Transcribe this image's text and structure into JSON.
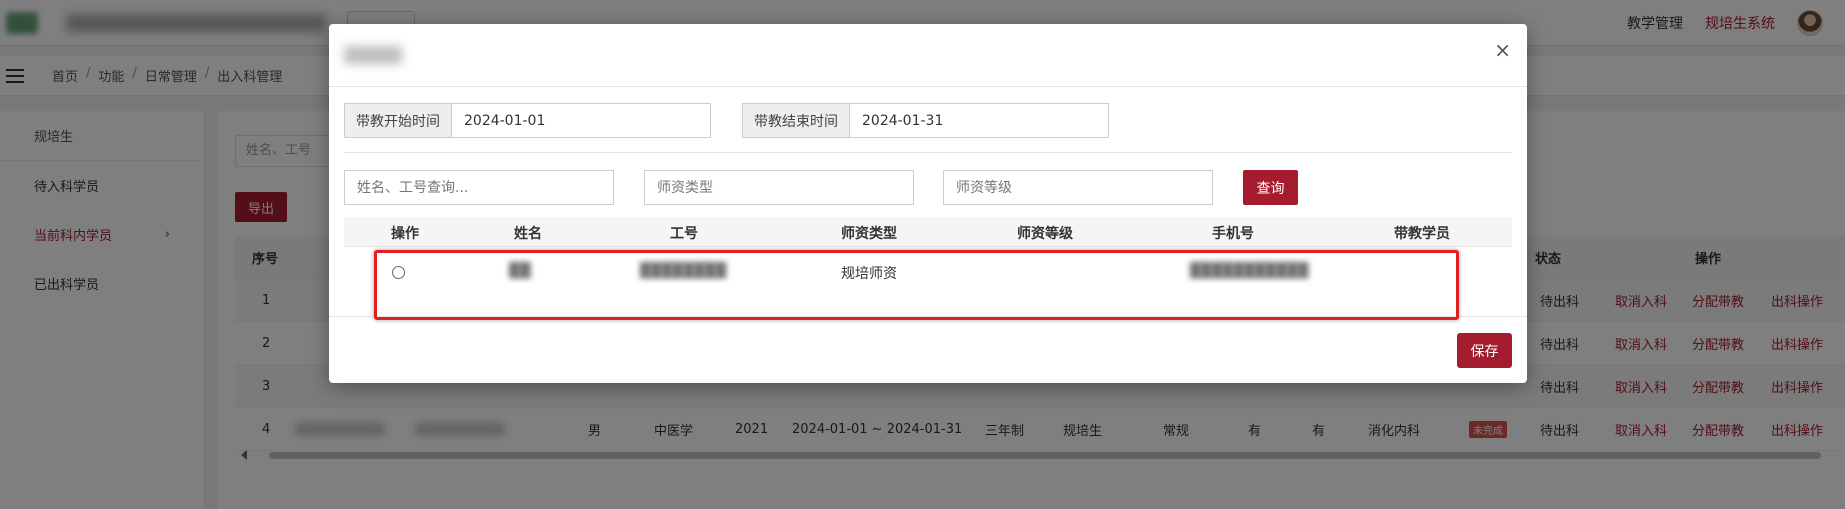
{
  "header": {
    "nav_links": [
      "教学管理",
      "规培生系统"
    ],
    "accent": "#a61c2f"
  },
  "breadcrumb": [
    "首页",
    "功能",
    "日常管理",
    "出入科管理"
  ],
  "sidebar": {
    "title": "规培生",
    "items": [
      {
        "label": "待入科学员"
      },
      {
        "label": "当前科内学员"
      },
      {
        "label": "已出科学员"
      }
    ]
  },
  "background": {
    "search_placeholder": "姓名、工号",
    "export_label": "导出",
    "headers": [
      "序号",
      "状态",
      "操作"
    ],
    "rows": [
      {
        "no": "1",
        "status": "待出科",
        "actions": [
          "取消入科",
          "分配带教",
          "出科操作"
        ]
      },
      {
        "no": "2",
        "status": "待出科",
        "actions": [
          "取消入科",
          "分配带教",
          "出科操作"
        ]
      },
      {
        "no": "3",
        "status": "待出科",
        "actions": [
          "取消入科",
          "分配带教",
          "出科操作"
        ]
      },
      {
        "no": "4",
        "gender": "男",
        "major": "中医学",
        "year": "2021",
        "period": "2024-01-01 ~ 2024-01-31",
        "system": "三年制",
        "type": "规培生",
        "mode": "常规",
        "flag1": "有",
        "flag2": "有",
        "dept": "消化内科",
        "badge": "未完成",
        "status": "待出科",
        "actions": [
          "取消入科",
          "分配带教",
          "出科操作"
        ]
      }
    ]
  },
  "modal": {
    "close_symbol": "×",
    "start_label": "带教开始时间",
    "start_value": "2024-01-01",
    "end_label": "带教结束时间",
    "end_value": "2024-01-31",
    "filters": {
      "name_placeholder": "姓名、工号查询...",
      "type_placeholder": "师资类型",
      "level_placeholder": "师资等级",
      "query_label": "查询"
    },
    "columns": [
      "操作",
      "姓名",
      "工号",
      "师资类型",
      "师资等级",
      "手机号",
      "带教学员"
    ],
    "rows": [
      {
        "name": "██",
        "id": "████████",
        "teacher_type": "规培师资",
        "level": "",
        "phone": "███████████",
        "students": ""
      }
    ],
    "save_label": "保存"
  }
}
